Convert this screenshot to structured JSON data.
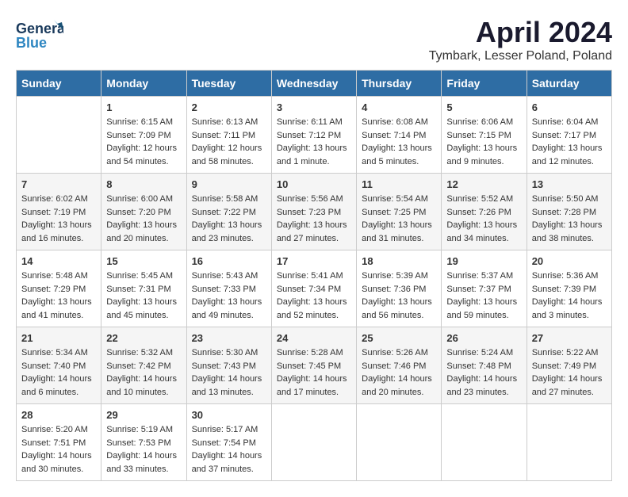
{
  "header": {
    "logo_line1": "General",
    "logo_line2": "Blue",
    "title": "April 2024",
    "subtitle": "Tymbark, Lesser Poland, Poland"
  },
  "days_of_week": [
    "Sunday",
    "Monday",
    "Tuesday",
    "Wednesday",
    "Thursday",
    "Friday",
    "Saturday"
  ],
  "weeks": [
    [
      {
        "day": "",
        "info": ""
      },
      {
        "day": "1",
        "info": "Sunrise: 6:15 AM\nSunset: 7:09 PM\nDaylight: 12 hours\nand 54 minutes."
      },
      {
        "day": "2",
        "info": "Sunrise: 6:13 AM\nSunset: 7:11 PM\nDaylight: 12 hours\nand 58 minutes."
      },
      {
        "day": "3",
        "info": "Sunrise: 6:11 AM\nSunset: 7:12 PM\nDaylight: 13 hours\nand 1 minute."
      },
      {
        "day": "4",
        "info": "Sunrise: 6:08 AM\nSunset: 7:14 PM\nDaylight: 13 hours\nand 5 minutes."
      },
      {
        "day": "5",
        "info": "Sunrise: 6:06 AM\nSunset: 7:15 PM\nDaylight: 13 hours\nand 9 minutes."
      },
      {
        "day": "6",
        "info": "Sunrise: 6:04 AM\nSunset: 7:17 PM\nDaylight: 13 hours\nand 12 minutes."
      }
    ],
    [
      {
        "day": "7",
        "info": "Sunrise: 6:02 AM\nSunset: 7:19 PM\nDaylight: 13 hours\nand 16 minutes."
      },
      {
        "day": "8",
        "info": "Sunrise: 6:00 AM\nSunset: 7:20 PM\nDaylight: 13 hours\nand 20 minutes."
      },
      {
        "day": "9",
        "info": "Sunrise: 5:58 AM\nSunset: 7:22 PM\nDaylight: 13 hours\nand 23 minutes."
      },
      {
        "day": "10",
        "info": "Sunrise: 5:56 AM\nSunset: 7:23 PM\nDaylight: 13 hours\nand 27 minutes."
      },
      {
        "day": "11",
        "info": "Sunrise: 5:54 AM\nSunset: 7:25 PM\nDaylight: 13 hours\nand 31 minutes."
      },
      {
        "day": "12",
        "info": "Sunrise: 5:52 AM\nSunset: 7:26 PM\nDaylight: 13 hours\nand 34 minutes."
      },
      {
        "day": "13",
        "info": "Sunrise: 5:50 AM\nSunset: 7:28 PM\nDaylight: 13 hours\nand 38 minutes."
      }
    ],
    [
      {
        "day": "14",
        "info": "Sunrise: 5:48 AM\nSunset: 7:29 PM\nDaylight: 13 hours\nand 41 minutes."
      },
      {
        "day": "15",
        "info": "Sunrise: 5:45 AM\nSunset: 7:31 PM\nDaylight: 13 hours\nand 45 minutes."
      },
      {
        "day": "16",
        "info": "Sunrise: 5:43 AM\nSunset: 7:33 PM\nDaylight: 13 hours\nand 49 minutes."
      },
      {
        "day": "17",
        "info": "Sunrise: 5:41 AM\nSunset: 7:34 PM\nDaylight: 13 hours\nand 52 minutes."
      },
      {
        "day": "18",
        "info": "Sunrise: 5:39 AM\nSunset: 7:36 PM\nDaylight: 13 hours\nand 56 minutes."
      },
      {
        "day": "19",
        "info": "Sunrise: 5:37 AM\nSunset: 7:37 PM\nDaylight: 13 hours\nand 59 minutes."
      },
      {
        "day": "20",
        "info": "Sunrise: 5:36 AM\nSunset: 7:39 PM\nDaylight: 14 hours\nand 3 minutes."
      }
    ],
    [
      {
        "day": "21",
        "info": "Sunrise: 5:34 AM\nSunset: 7:40 PM\nDaylight: 14 hours\nand 6 minutes."
      },
      {
        "day": "22",
        "info": "Sunrise: 5:32 AM\nSunset: 7:42 PM\nDaylight: 14 hours\nand 10 minutes."
      },
      {
        "day": "23",
        "info": "Sunrise: 5:30 AM\nSunset: 7:43 PM\nDaylight: 14 hours\nand 13 minutes."
      },
      {
        "day": "24",
        "info": "Sunrise: 5:28 AM\nSunset: 7:45 PM\nDaylight: 14 hours\nand 17 minutes."
      },
      {
        "day": "25",
        "info": "Sunrise: 5:26 AM\nSunset: 7:46 PM\nDaylight: 14 hours\nand 20 minutes."
      },
      {
        "day": "26",
        "info": "Sunrise: 5:24 AM\nSunset: 7:48 PM\nDaylight: 14 hours\nand 23 minutes."
      },
      {
        "day": "27",
        "info": "Sunrise: 5:22 AM\nSunset: 7:49 PM\nDaylight: 14 hours\nand 27 minutes."
      }
    ],
    [
      {
        "day": "28",
        "info": "Sunrise: 5:20 AM\nSunset: 7:51 PM\nDaylight: 14 hours\nand 30 minutes."
      },
      {
        "day": "29",
        "info": "Sunrise: 5:19 AM\nSunset: 7:53 PM\nDaylight: 14 hours\nand 33 minutes."
      },
      {
        "day": "30",
        "info": "Sunrise: 5:17 AM\nSunset: 7:54 PM\nDaylight: 14 hours\nand 37 minutes."
      },
      {
        "day": "",
        "info": ""
      },
      {
        "day": "",
        "info": ""
      },
      {
        "day": "",
        "info": ""
      },
      {
        "day": "",
        "info": ""
      }
    ]
  ]
}
